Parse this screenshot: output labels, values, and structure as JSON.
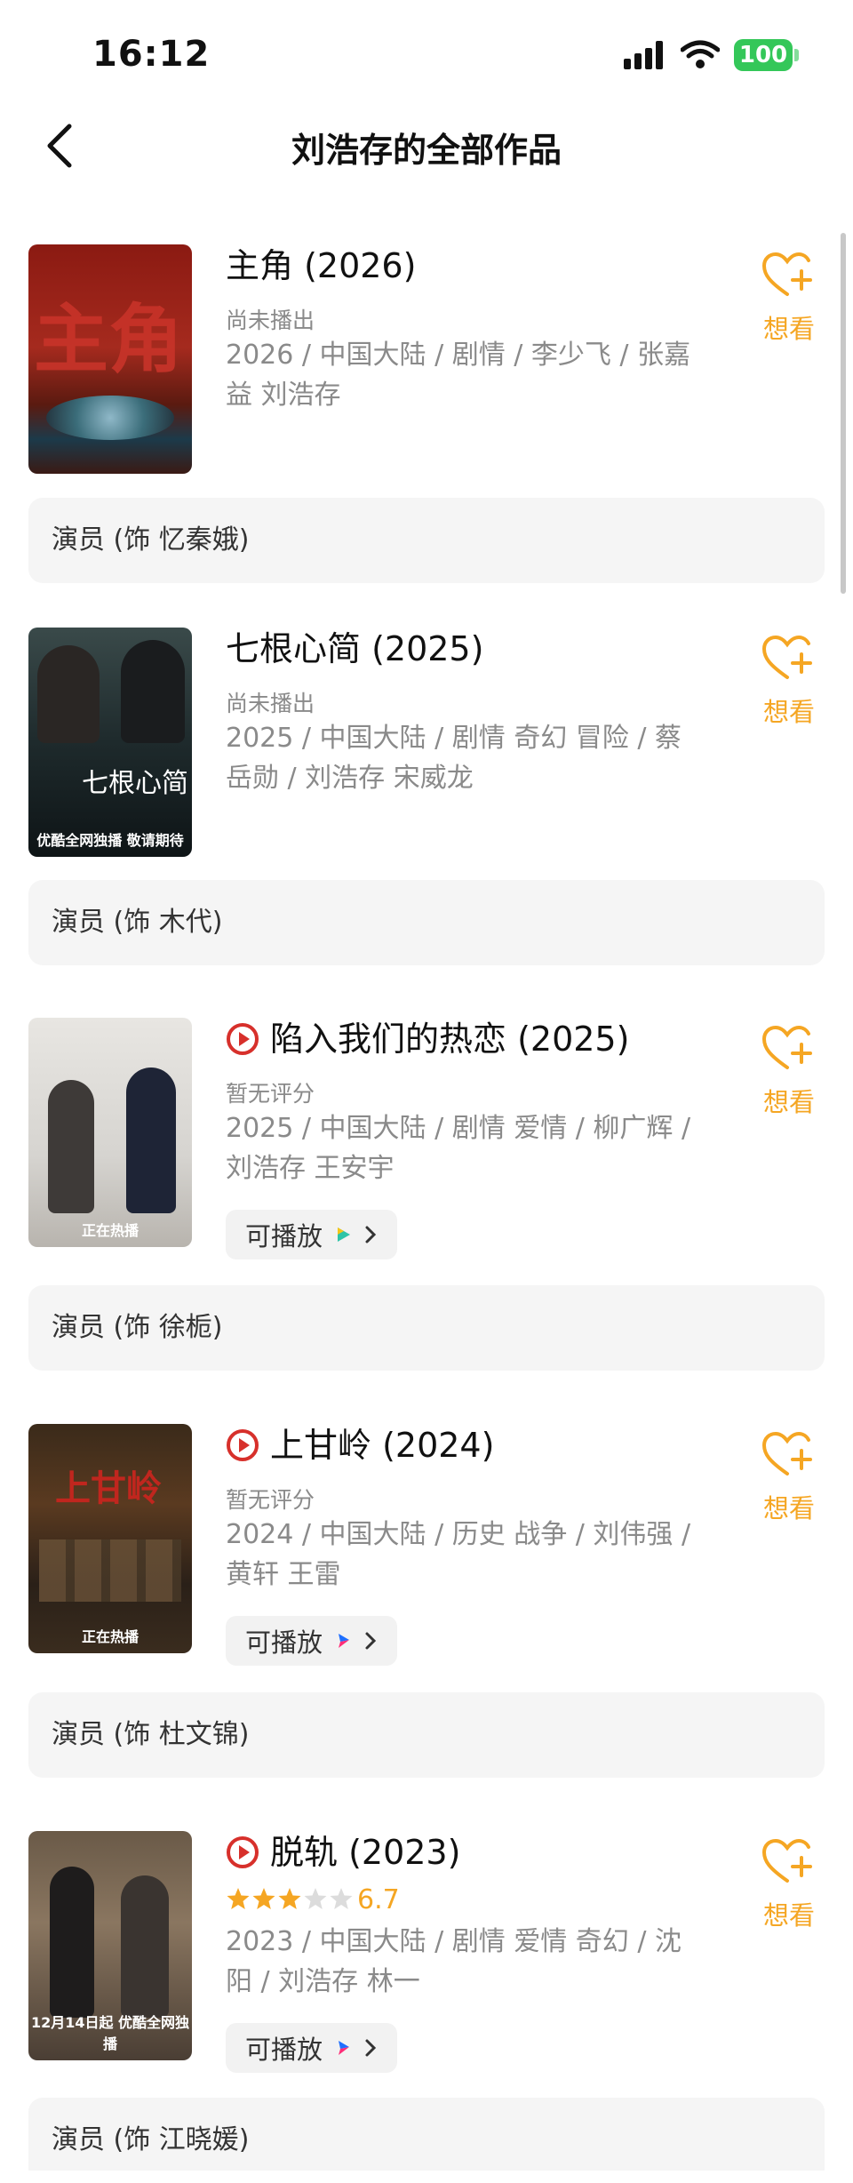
{
  "status_bar": {
    "time": "16:12",
    "battery": "100"
  },
  "nav": {
    "title": "刘浩存的全部作品"
  },
  "colors": {
    "accent": "#f5a623",
    "play_red": "#d7302b",
    "role_bg": "#f5f5f5"
  },
  "works": [
    {
      "title": "主角 (2026)",
      "status": "尚未播出",
      "meta": "2026 / 中国大陆 / 剧情 / 李少飞 / 张嘉益 刘浩存",
      "wish_label": "想看",
      "role": "演员 (饰 忆秦娥)",
      "poster_text": ""
    },
    {
      "title": "七根心简 (2025)",
      "status": "尚未播出",
      "meta": "2025 / 中国大陆 / 剧情 奇幻 冒险 / 蔡岳勋 / 刘浩存 宋威龙",
      "wish_label": "想看",
      "role": "演员 (饰 木代)",
      "poster_text": "优酷全网独播 敬请期待"
    },
    {
      "title": "陷入我们的热恋 (2025)",
      "status": "暂无评分",
      "meta": "2025 / 中国大陆 / 剧情 爱情 / 柳广辉 / 刘浩存 王安宇",
      "playable": "可播放",
      "wish_label": "想看",
      "role": "演员 (饰 徐栀)",
      "poster_text": "正在热播"
    },
    {
      "title": "上甘岭 (2024)",
      "status": "暂无评分",
      "meta": "2024 / 中国大陆 / 历史 战争 / 刘伟强 / 黄轩 王雷",
      "playable": "可播放",
      "wish_label": "想看",
      "role": "演员 (饰 杜文锦)",
      "poster_text": "正在热播"
    },
    {
      "title": "脱轨 (2023)",
      "rating": "6.7",
      "rating_stars": 3.5,
      "meta": "2023 / 中国大陆 / 剧情 爱情 奇幻 / 沈阳 / 刘浩存 林一",
      "playable": "可播放",
      "wish_label": "想看",
      "role": "演员 (饰 江晓媛)",
      "poster_text": "12月14日起 优酷全网独播"
    }
  ]
}
